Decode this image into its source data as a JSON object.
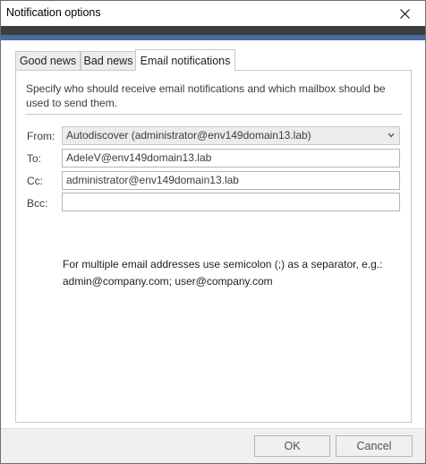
{
  "window": {
    "title": "Notification options"
  },
  "tabs": [
    {
      "label": "Good news",
      "active": false
    },
    {
      "label": "Bad news",
      "active": false
    },
    {
      "label": "Email notifications",
      "active": true
    }
  ],
  "email_panel": {
    "description": "Specify who should receive email notifications and which mailbox should be used to send them.",
    "from": {
      "label": "From:",
      "value": "Autodiscover (administrator@env149domain13.lab)"
    },
    "to": {
      "label": "To:",
      "value": "AdeleV@env149domain13.lab"
    },
    "cc": {
      "label": "Cc:",
      "value": "administrator@env149domain13.lab"
    },
    "bcc": {
      "label": "Bcc:",
      "value": ""
    },
    "hint": "For multiple email addresses use semicolon (;) as a separator, e.g.: admin@company.com; user@company.com"
  },
  "buttons": {
    "ok": "OK",
    "cancel": "Cancel"
  },
  "icons": {
    "close": "close-icon",
    "dropdown": "chevron-down-icon"
  },
  "colors": {
    "banner_dark": "#3a3f44",
    "banner_accent": "#4a6a9a"
  }
}
